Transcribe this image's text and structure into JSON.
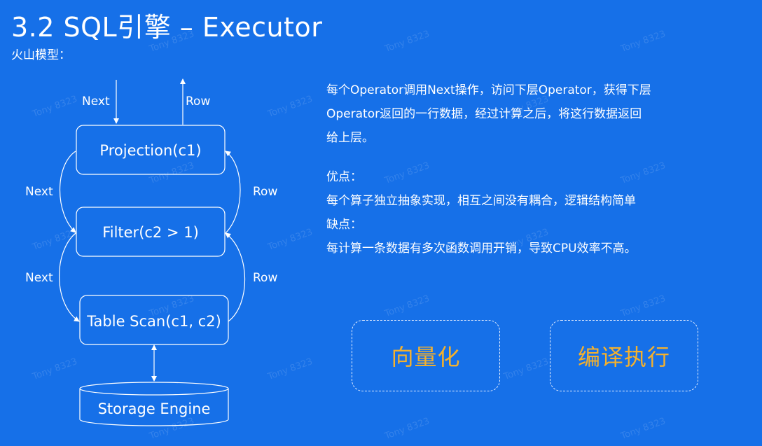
{
  "title": "3.2 SQL引擎 –  Executor",
  "subtitle": "火山模型：",
  "diagram": {
    "nodes": {
      "projection": "Projection(c1)",
      "filter": "Filter(c2 > 1)",
      "table_scan": "Table Scan(c1, c2)",
      "storage": "Storage Engine"
    },
    "edges": {
      "next": "Next",
      "row": "Row"
    }
  },
  "description": {
    "lines": [
      "每个Operator调用Next操作，访问下层Operator，获得下层",
      "Operator返回的一行数据，经过计算之后，将这行数据返回",
      "给上层。"
    ],
    "pros_title": "优点：",
    "pros": "每个算子独立抽象实现，相互之间没有耦合，逻辑结构简单",
    "cons_title": "缺点：",
    "cons": "每计算一条数据有多次函数调用开销，导致CPU效率不高。"
  },
  "badges": [
    "向量化",
    "编译执行"
  ],
  "watermark": "Tony 8323",
  "colors": {
    "background": "#1670e8",
    "accent": "#f5b12c",
    "foreground": "#ffffff"
  }
}
